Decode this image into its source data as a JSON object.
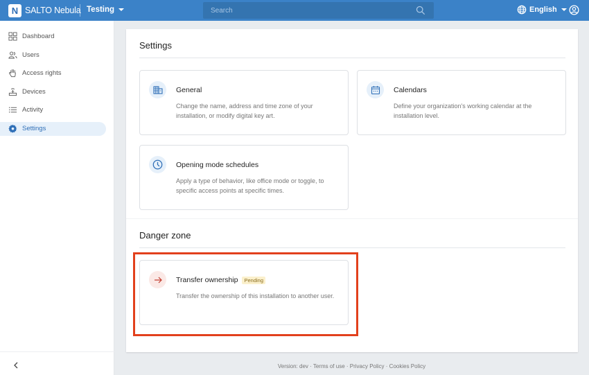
{
  "app": {
    "brand": "SALTO Nebula",
    "logo_letter": "N",
    "installation": "Testing",
    "search_placeholder": "Search",
    "language": "English",
    "accent_color": "#3b82c8"
  },
  "sidebar": {
    "items": [
      {
        "label": "Dashboard",
        "icon": "dashboard-icon",
        "active": false
      },
      {
        "label": "Users",
        "icon": "users-icon",
        "active": false
      },
      {
        "label": "Access rights",
        "icon": "hand-icon",
        "active": false
      },
      {
        "label": "Devices",
        "icon": "device-icon",
        "active": false
      },
      {
        "label": "Activity",
        "icon": "list-icon",
        "active": false
      },
      {
        "label": "Settings",
        "icon": "gear-icon",
        "active": true
      }
    ],
    "collapse_icon": "chevron-left-icon"
  },
  "main": {
    "settings_title": "Settings",
    "cards": [
      {
        "title": "General",
        "icon": "building-icon",
        "description": "Change the name, address and time zone of your installation, or modify digital key art."
      },
      {
        "title": "Calendars",
        "icon": "calendar-icon",
        "description": "Define your organization's working calendar at the installation level."
      },
      {
        "title": "Opening mode schedules",
        "icon": "clock-icon",
        "description": "Apply a type of behavior, like office mode or toggle, to specific access points at specific times."
      }
    ],
    "danger_title": "Danger zone",
    "danger_cards": [
      {
        "title": "Transfer ownership",
        "badge": "Pending",
        "icon": "arrow-right-icon",
        "description": "Transfer the ownership of this installation to another user."
      }
    ],
    "highlight_color": "#e2401c"
  },
  "footer": {
    "version": "Version: dev",
    "separator": " · ",
    "links": [
      "Terms of use",
      "Privacy Policy",
      "Cookies Policy"
    ]
  }
}
